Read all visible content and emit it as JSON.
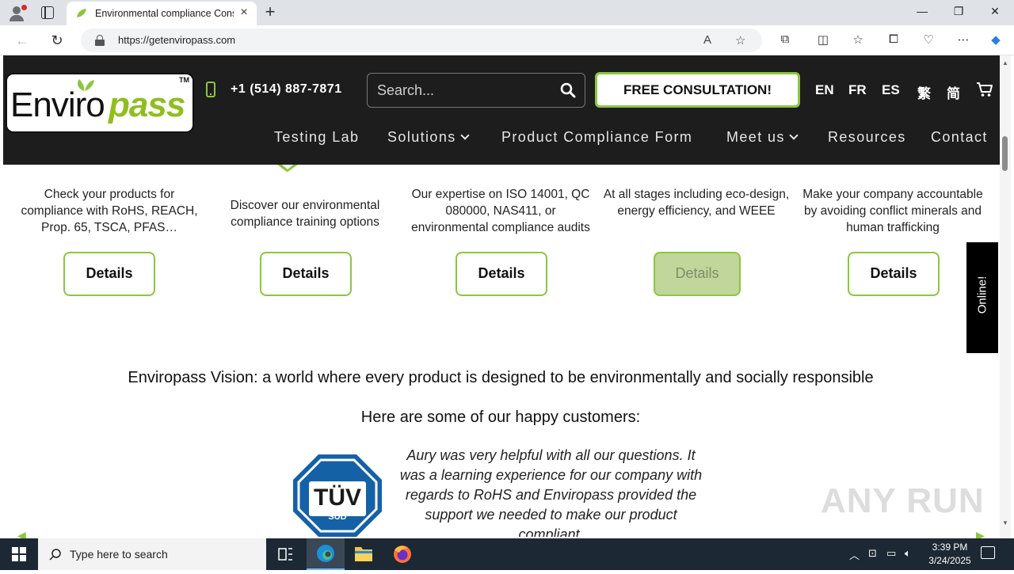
{
  "browser": {
    "tab_title": "Environmental compliance Cons",
    "url": "https://getenviropass.com",
    "window_controls": {
      "minimize": "—",
      "restore": "❐",
      "close": "✕"
    },
    "new_tab": "+"
  },
  "header": {
    "logo": {
      "text_a": "Enviro",
      "text_b": "pass",
      "tm": "TM"
    },
    "phone": "+1 (514) 887-7871",
    "search_placeholder": "Search...",
    "cta": "FREE CONSULTATION!",
    "languages": [
      "EN",
      "FR",
      "ES",
      "繁",
      "简"
    ],
    "menu": [
      {
        "label": "Testing Lab",
        "dropdown": false
      },
      {
        "label": "Solutions",
        "dropdown": true
      },
      {
        "label": "Product Compliance Form",
        "dropdown": false
      },
      {
        "label": "Meet us",
        "dropdown": true
      },
      {
        "label": "Resources",
        "dropdown": false
      },
      {
        "label": "Contact",
        "dropdown": false
      }
    ]
  },
  "cards": [
    {
      "text": "Check your products for compliance with RoHS, REACH, Prop. 65, TSCA, PFAS…",
      "button": "Details"
    },
    {
      "text": "Discover our environmental compliance training options",
      "button": "Details"
    },
    {
      "text": "Our expertise on ISO 14001, QC 080000, NAS411, or environmental compliance audits",
      "button": "Details"
    },
    {
      "text": "At all stages including eco-design, energy efficiency, and WEEE",
      "button": "Details"
    },
    {
      "text": "Make your company accountable by avoiding conflict minerals and human trafficking",
      "button": "Details"
    }
  ],
  "online_tab": "Online!",
  "vision": "Enviropass Vision: a world where every product is designed to be environmentally and socially responsible",
  "customers_heading": "Here are some of our happy customers:",
  "testimonial": {
    "logo_top": "TÜV",
    "logo_bottom": "SÜD",
    "quote": "Aury was very helpful with all our questions. It was a learning experience for our company with regards to RoHS and Enviropass provided the support we needed to make our product compliant."
  },
  "watermark": "ANY RUN",
  "taskbar": {
    "search_placeholder": "Type here to search",
    "time": "3:39 PM",
    "date": "3/24/2025"
  },
  "colors": {
    "brand_green": "#8cc63f",
    "header_bg": "#1d1d1d"
  }
}
